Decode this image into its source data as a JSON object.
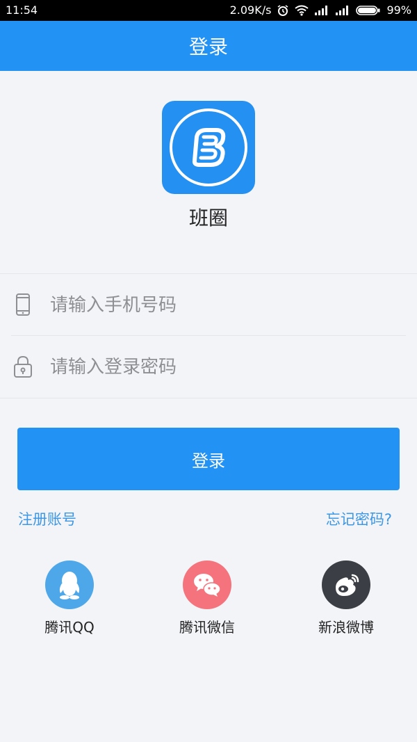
{
  "status_bar": {
    "time": "11:54",
    "speed": "2.09K/s",
    "battery": "99%"
  },
  "title_bar": {
    "title": "登录"
  },
  "app": {
    "name": "班圈",
    "logo_letter": "B",
    "brand_color": "#2490f2"
  },
  "form": {
    "phone_placeholder": "请输入手机号码",
    "password_placeholder": "请输入登录密码",
    "login_button": "登录"
  },
  "links": {
    "register": "注册账号",
    "forgot_password": "忘记密码?"
  },
  "social": [
    {
      "label": "腾讯QQ",
      "icon": "qq-icon",
      "color": "#4da7e8"
    },
    {
      "label": "腾讯微信",
      "icon": "wechat-icon",
      "color": "#f5737d"
    },
    {
      "label": "新浪微博",
      "icon": "weibo-icon",
      "color": "#3b3e44"
    }
  ]
}
